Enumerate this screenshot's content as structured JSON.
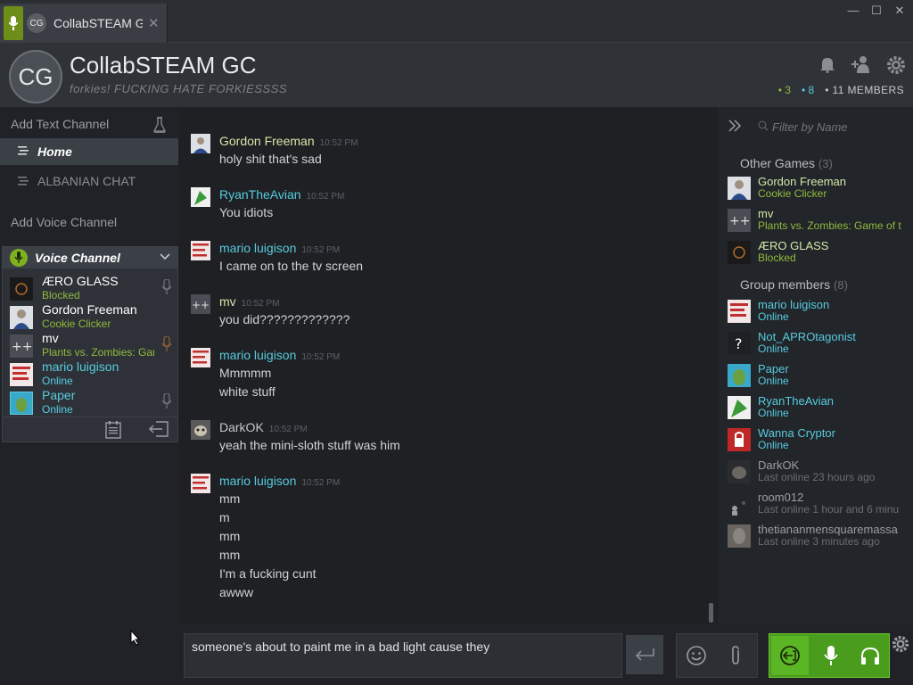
{
  "tab": {
    "initials": "CG",
    "title": "CollabSTEAM G",
    "close": "✕"
  },
  "window_controls": {
    "minimize": "—",
    "maximize": "☐",
    "close": "✕"
  },
  "header": {
    "initials": "CG",
    "title": "CollabSTEAM GC",
    "subtitle": "forkies! FUCKING HATE FORKIESSSS",
    "count_ingame": "• 3",
    "count_online": "• 8",
    "count_members": "• 11 MEMBERS"
  },
  "left": {
    "add_text_channel": "Add Text Channel",
    "home": "Home",
    "albanian": "ALBANIAN CHAT",
    "add_voice_channel": "Add Voice Channel",
    "voice_channel": "Voice Channel",
    "voice_members": [
      {
        "name": "ÆRO GLASS",
        "status": "Blocked",
        "status_color": "#90ba3c",
        "name_color": "#ffffff"
      },
      {
        "name": "Gordon Freeman",
        "status": "Cookie Clicker",
        "status_color": "#90ba3c",
        "name_color": "#ffffff"
      },
      {
        "name": "mv",
        "status": "Plants vs. Zombies: Game of t",
        "status_color": "#90ba3c",
        "name_color": "#ffffff"
      },
      {
        "name": "mario luigison",
        "status": "Online",
        "status_color": "#57cbde",
        "name_color": "#57cbde"
      },
      {
        "name": "Paper",
        "status": "Online",
        "status_color": "#57cbde",
        "name_color": "#57cbde"
      }
    ]
  },
  "chat": {
    "messages": [
      {
        "author": "Gordon Freeman",
        "color": "#d4e8a8",
        "time": "10:52 PM",
        "lines": [
          "holy shit that's sad"
        ]
      },
      {
        "author": "RyanTheAvian",
        "color": "#57cbde",
        "time": "10:52 PM",
        "lines": [
          "You idiots"
        ]
      },
      {
        "author": "mario luigison",
        "color": "#57cbde",
        "time": "10:52 PM",
        "lines": [
          "I came on to the tv screen"
        ]
      },
      {
        "author": "mv",
        "color": "#d4e8a8",
        "time": "10:52 PM",
        "lines": [
          "you did?????????????"
        ]
      },
      {
        "author": "mario luigison",
        "color": "#57cbde",
        "time": "10:52 PM",
        "lines": [
          "Mmmmm",
          "white stuff"
        ]
      },
      {
        "author": "DarkOK",
        "color": "#c6c8cc",
        "time": "10:52 PM",
        "lines": [
          "yeah the mini-sloth stuff was him"
        ]
      },
      {
        "author": "mario luigison",
        "color": "#57cbde",
        "time": "10:52 PM",
        "lines": [
          "mm",
          "m",
          "mm",
          "mm",
          "I'm a fucking cunt",
          "awww"
        ]
      }
    ],
    "input_value": "someone's about to paint me in a bad light cause they"
  },
  "right": {
    "filter_placeholder": "Filter by Name",
    "other_games_label": "Other Games",
    "other_games_count": "(3)",
    "other_games": [
      {
        "name": "Gordon Freeman",
        "status": "Cookie Clicker"
      },
      {
        "name": "mv",
        "status": "Plants vs. Zombies: Game of t"
      },
      {
        "name": "ÆRO GLASS",
        "status": "Blocked"
      }
    ],
    "group_members_label": "Group members",
    "group_members_count": "(8)",
    "group_members": [
      {
        "name": "mario luigison",
        "status": "Online",
        "name_color": "#57cbde",
        "status_color": "#57cbde"
      },
      {
        "name": "Not_APROtagonist",
        "status": "Online",
        "name_color": "#57cbde",
        "status_color": "#57cbde"
      },
      {
        "name": "Paper",
        "status": "Online",
        "name_color": "#57cbde",
        "status_color": "#57cbde"
      },
      {
        "name": "RyanTheAvian",
        "status": "Online",
        "name_color": "#57cbde",
        "status_color": "#57cbde"
      },
      {
        "name": "Wanna Cryptor",
        "status": "Online",
        "name_color": "#57cbde",
        "status_color": "#57cbde"
      },
      {
        "name": "DarkOK",
        "status": "Last online 23 hours ago",
        "name_color": "#9a9ea4",
        "status_color": "#6a6e74"
      },
      {
        "name": "room012",
        "status": "Last online 1 hour and 6 minu",
        "name_color": "#9a9ea4",
        "status_color": "#6a6e74"
      },
      {
        "name": "thetiananmensquaremassa",
        "status": "Last online 3 minutes ago",
        "name_color": "#9a9ea4",
        "status_color": "#6a6e74"
      }
    ]
  },
  "colors": {
    "ingame_green": "#90ba3c",
    "online_blue": "#57cbde",
    "voice_green": "#5bb625"
  }
}
